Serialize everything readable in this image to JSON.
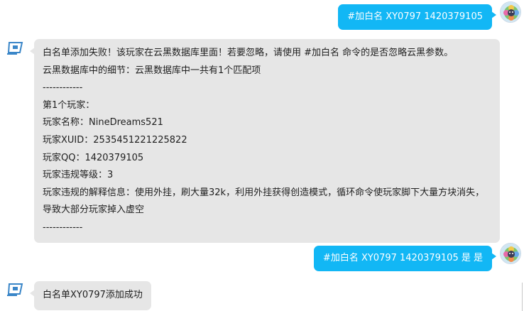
{
  "messages": [
    {
      "side": "outgoing",
      "text": "#加白名 XY0797 1420379105"
    },
    {
      "side": "incoming",
      "lines": [
        "白名单添加失败！该玩家在云黑数据库里面！若要忽略，请使用 #加白名 命令的是否忽略云黑参数。",
        "云黑数据库中的细节：云黑数据库中一共有1个匹配项",
        "------------",
        "第1个玩家：",
        "玩家名称：NineDreams521",
        "玩家XUID：2535451221225822",
        "玩家QQ：1420379105",
        "玩家违规等级：3",
        "玩家违规的解释信息：使用外挂，刷大量32k，利用外挂获得创造模式，循环命令使玩家脚下大量方块消失，导致大部分玩家掉入虚空",
        "------------"
      ]
    },
    {
      "side": "outgoing",
      "text": "#加白名 XY0797 1420379105 是 是"
    },
    {
      "side": "incoming",
      "lines": [
        "白名单XY0797添加成功"
      ]
    }
  ],
  "icons": {
    "user_avatar": "user-avatar-icon",
    "bot_avatar": "bot-avatar-icon"
  },
  "colors": {
    "outgoing_bubble": "#12b7f5",
    "incoming_bubble": "#e6e6e6",
    "bot_icon": "#3a86c8"
  }
}
